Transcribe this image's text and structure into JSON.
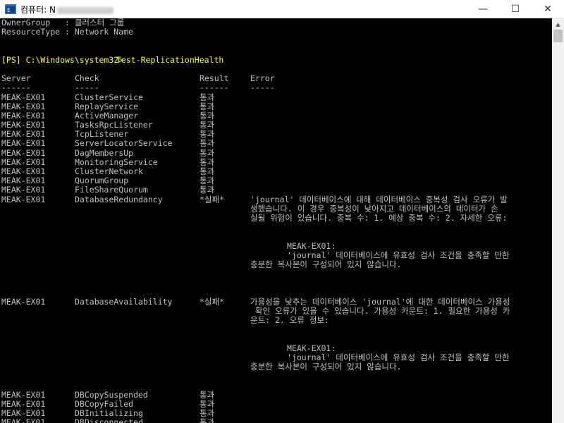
{
  "window": {
    "title": "컴퓨터: N",
    "controls": {
      "minimize": "—",
      "maximize": "☐",
      "close": "✕"
    },
    "icon": "powershell-icon"
  },
  "console": {
    "owner_line": "OwnerGroup   : 클러스터 그룹",
    "resource_line": "ResourceType : Network Name",
    "prompt": "[PS] C:\\Windows\\system32>",
    "command": "Test-ReplicationHealth",
    "headers": {
      "server": "Server",
      "check": "Check",
      "result": "Result",
      "error": "Error"
    },
    "underlines": {
      "server": "------",
      "check": "-----",
      "result": "------",
      "error": "-----"
    },
    "rows_top": [
      {
        "server": "MEAK-EX01",
        "check": "ClusterService",
        "result": "통과"
      },
      {
        "server": "MEAK-EX01",
        "check": "ReplayService",
        "result": "통과"
      },
      {
        "server": "MEAK-EX01",
        "check": "ActiveManager",
        "result": "통과"
      },
      {
        "server": "MEAK-EX01",
        "check": "TasksRpcListener",
        "result": "통과"
      },
      {
        "server": "MEAK-EX01",
        "check": "TcpListener",
        "result": "통과"
      },
      {
        "server": "MEAK-EX01",
        "check": "ServerLocatorService",
        "result": "통과"
      },
      {
        "server": "MEAK-EX01",
        "check": "DagMembersUp",
        "result": "통과"
      },
      {
        "server": "MEAK-EX01",
        "check": "MonitoringService",
        "result": "통과"
      },
      {
        "server": "MEAK-EX01",
        "check": "ClusterNetwork",
        "result": "통과"
      },
      {
        "server": "MEAK-EX01",
        "check": "QuorumGroup",
        "result": "통과"
      },
      {
        "server": "MEAK-EX01",
        "check": "FileShareQuorum",
        "result": "통과"
      }
    ],
    "fail1": {
      "server": "MEAK-EX01",
      "check": "DatabaseRedundancy",
      "result": "*실패*",
      "error_lines": [
        "'journal' 데이터베이스에 대해 데이터베이스 중복성 검사 오류가 발",
        "생했습니다. 이 경우 중복성이 낮아지고 데이터베이스의 데이터가 손",
        "실될 위험이 있습니다. 중복 수: 1. 예상 중복 수: 2. 자세한 오류:"
      ],
      "detail_server": "MEAK-EX01:",
      "detail_lines": [
        "'journal' 데이터베이스에 유효성 검사 조건을 충족할 만한",
        "충분한 복사본이 구성되어 있지 않습니다."
      ]
    },
    "fail2": {
      "server": "MEAK-EX01",
      "check": "DatabaseAvailability",
      "result": "*실패*",
      "error_lines": [
        "가용성을 낮추는 데이터베이스 'journal'에 대한 데이터베이스 가용성",
        " 확인 오류가 있을 수 있습니다. 가용성 카운트: 1. 필요한 가용성 카",
        "운트: 2. 오류 정보:"
      ],
      "detail_server": "MEAK-EX01:",
      "detail_lines": [
        "'journal' 데이터베이스에 유효성 검사 조건을 충족할 만한",
        "충분한 복사본이 구성되어 있지 않습니다."
      ]
    },
    "rows_bottom": [
      {
        "server": "MEAK-EX01",
        "check": "DBCopySuspended",
        "result": "통과"
      },
      {
        "server": "MEAK-EX01",
        "check": "DBCopyFailed",
        "result": "통과"
      },
      {
        "server": "MEAK-EX01",
        "check": "DBInitializing",
        "result": "통과"
      },
      {
        "server": "MEAK-EX01",
        "check": "DBDisconnected",
        "result": "통과"
      }
    ]
  },
  "scrollbar": {
    "up_arrow": "▲"
  }
}
